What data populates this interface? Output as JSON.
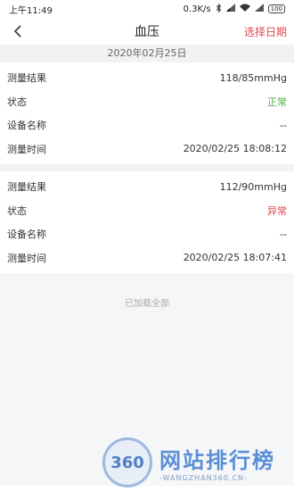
{
  "status_bar": {
    "time": "上午11:49",
    "network_speed": "0.3K/s",
    "battery": "100"
  },
  "nav": {
    "title": "血压",
    "action_label": "选择日期",
    "back_icon": "chevron-left-icon"
  },
  "date_header": "2020年02月25日",
  "records": [
    {
      "rows": [
        {
          "label": "测量结果",
          "value": "118/85mmHg"
        },
        {
          "label": "状态",
          "value": "正常"
        },
        {
          "label": "设备名称",
          "value": "--"
        },
        {
          "label": "测量时间",
          "value": "2020/02/25 18:08:12"
        }
      ]
    },
    {
      "rows": [
        {
          "label": "测量结果",
          "value": "112/90mmHg"
        },
        {
          "label": "状态",
          "value": "异常"
        },
        {
          "label": "设备名称",
          "value": "--"
        },
        {
          "label": "测量时间",
          "value": "2020/02/25 18:07:41"
        }
      ]
    }
  ],
  "footer": {
    "loaded_all": "已加载全部"
  },
  "watermark": {
    "logo_text": "360",
    "main": "网站排行榜",
    "sub": "-WANGZHAN360.CN-"
  },
  "colors": {
    "accent": "#e0474c",
    "normal": "#4fb24a",
    "abnormal": "#e0474c",
    "section_bg": "#f1f2f4"
  }
}
